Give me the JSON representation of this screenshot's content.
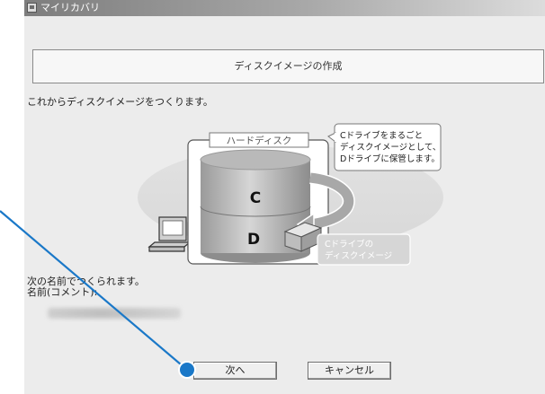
{
  "window": {
    "title": "マイリカバリ",
    "icon": "app-window-icon"
  },
  "header": {
    "title": "ディスクイメージの作成"
  },
  "intro": {
    "text": "これからディスクイメージをつくります。"
  },
  "illustration": {
    "hdd_label": "ハードディスク",
    "drive_c": "C",
    "drive_d": "D",
    "callout_lines": [
      "Cドライブをまるごと",
      "ディスクイメージとして、",
      "Dドライブに保管します。"
    ],
    "image_label_lines": [
      "Cドライブの",
      "ディスクイメージ"
    ]
  },
  "name_section": {
    "line1": "次の名前でつくられます。",
    "line2": "名前(コメント):"
  },
  "buttons": {
    "next": "次へ",
    "cancel": "キャンセル"
  },
  "colors": {
    "titlebar": "#8a8a8a",
    "background": "#ececec",
    "highlight_dot": "#1a78c8",
    "pointer_line": "#1a78c8"
  }
}
